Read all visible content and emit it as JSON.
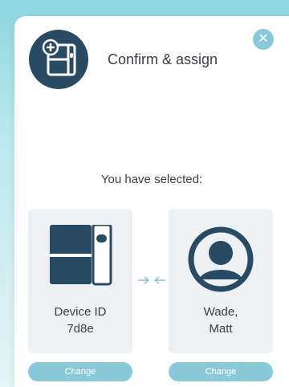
{
  "dialog": {
    "title": "Confirm & assign",
    "close_label": "✕"
  },
  "selection": {
    "heading": "You have selected:",
    "device": {
      "line1": "Device ID",
      "line2": "7d8e",
      "change_label": "Change",
      "icon": "device-icon"
    },
    "user": {
      "line1": "Wade,",
      "line2": "Matt",
      "change_label": "Change",
      "icon": "user-avatar-icon"
    },
    "link_icon": "link-arrows-icon"
  },
  "colors": {
    "accent": "#8ac9d8",
    "dark": "#284a62",
    "card_bg": "#eef1f3"
  }
}
